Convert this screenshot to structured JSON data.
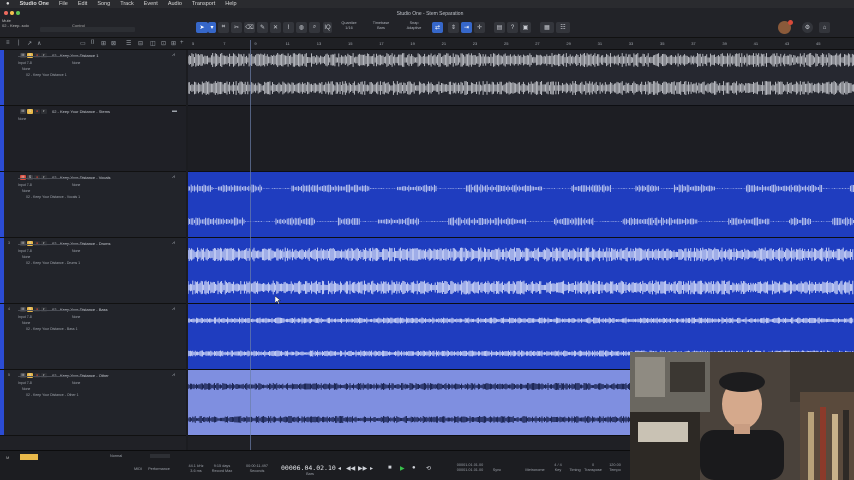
{
  "menubar": {
    "app": "Studio One",
    "items": [
      "File",
      "Edit",
      "Song",
      "Track",
      "Event",
      "Audio",
      "Transport",
      "Help"
    ]
  },
  "window": {
    "title": "Studio One - Stem Separation"
  },
  "song": {
    "line1": "Mute",
    "line2": "02 - Keep..solo"
  },
  "control_label": "Control",
  "toolbar": {
    "quantize_label": "Quantize",
    "quantize_value": "1/16",
    "timebase_label": "Timebase",
    "timebase_value": "Bars",
    "snap_label": "Snap",
    "snap_value": "Adaptive",
    "iq_label": "IQ"
  },
  "ruler_marks": [
    "5",
    "7",
    "9",
    "11",
    "13",
    "15",
    "17",
    "19",
    "21",
    "23",
    "25",
    "27",
    "29",
    "31",
    "33",
    "35",
    "37",
    "39",
    "41",
    "43",
    "45"
  ],
  "tracks": [
    {
      "num": "",
      "name": "02 - Keep Your Distance 1",
      "input": "Input 7-8",
      "send": "None",
      "route": "02 - Keep Your Distance 1",
      "auto": "None"
    },
    {
      "num": "",
      "name": "02 - Keep Your Distance - Stems",
      "input": "None",
      "send": "",
      "route": "",
      "auto": ""
    },
    {
      "num": "",
      "name": "02 - Keep Your Distance - Vocals",
      "input": "Input 7-8",
      "send": "None",
      "route": "02 - Keep Your Distance - Vocals 1",
      "auto": "None"
    },
    {
      "num": "3",
      "name": "02 - Keep Your Distance - Drums",
      "input": "Input 7-8",
      "send": "None",
      "route": "02 - Keep Your Distance - Drums 1",
      "auto": "None"
    },
    {
      "num": "4",
      "name": "02 - Keep Your Distance - Bass",
      "input": "Input 7-8",
      "send": "None",
      "route": "02 - Keep Your Distance - Bass 1",
      "auto": "None"
    },
    {
      "num": "5",
      "name": "02 - Keep Your Distance - Other",
      "input": "Input 7-8",
      "send": "None",
      "route": "02 - Keep Your Distance - Other 1",
      "auto": "None"
    }
  ],
  "mute_label": "M",
  "solo_label": "S",
  "bottom": {
    "midi": "MIDI",
    "performance": "Performance",
    "sample_rate": "44.1 kHz",
    "latency": "3.6 ms",
    "record_days": "9:15 days",
    "record_max": "Record Max",
    "seconds_time": "00:00:11.497",
    "seconds_label": "Seconds",
    "timecode": "00006.04.02.10",
    "bars_label": "Bars",
    "loop_start": "00001.01.01.00",
    "loop_end": "00001.01.01.00",
    "sync": "Sync",
    "metronome": "Metronome",
    "time_sig": "4 / 4",
    "key_label": "Key",
    "timing": "Timing",
    "transpose": "0",
    "transpose_label": "Transpose",
    "tempo": "120.00",
    "tempo_label": "Tempo",
    "normal_label": "Normal"
  },
  "colors": {
    "accent": "#3667c9",
    "track_blue": "#1e3fbf",
    "track_selected": "#7b8de0",
    "record_red": "#d84a3a"
  }
}
